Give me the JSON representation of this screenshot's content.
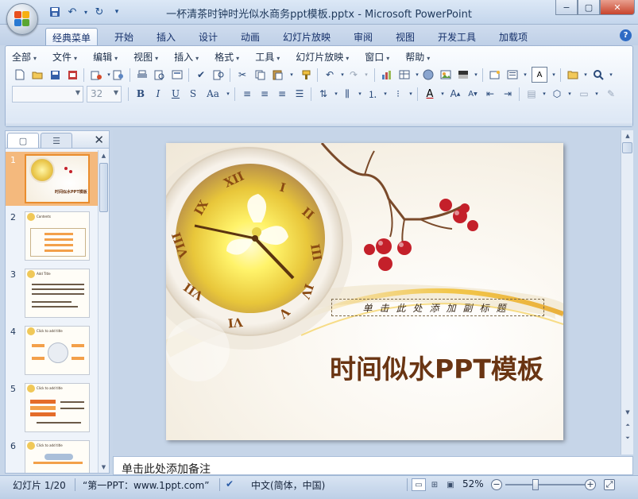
{
  "window": {
    "title": "一杯清茶时钟时光似水商务ppt模板.pptx - Microsoft PowerPoint",
    "controls": [
      "−",
      "▢",
      "✕"
    ]
  },
  "quick_access": {
    "icons": [
      "save-icon",
      "undo-icon",
      "redo-icon",
      "customize-icon"
    ]
  },
  "ribbon_tabs": [
    {
      "label": "经典菜单",
      "active": true
    },
    {
      "label": "开始"
    },
    {
      "label": "插入"
    },
    {
      "label": "设计"
    },
    {
      "label": "动画"
    },
    {
      "label": "幻灯片放映"
    },
    {
      "label": "审阅"
    },
    {
      "label": "视图"
    },
    {
      "label": "开发工具"
    },
    {
      "label": "加载项"
    }
  ],
  "menu": [
    {
      "label": "全部"
    },
    {
      "label": "文件"
    },
    {
      "label": "编辑"
    },
    {
      "label": "视图"
    },
    {
      "label": "插入"
    },
    {
      "label": "格式"
    },
    {
      "label": "工具"
    },
    {
      "label": "幻灯片放映"
    },
    {
      "label": "窗口"
    },
    {
      "label": "帮助"
    }
  ],
  "format": {
    "font_name": "",
    "font_size": "32",
    "bold": "B",
    "italic": "I",
    "underline": "U",
    "strike": "S",
    "case": "Aa",
    "font_color": "A",
    "text_box": "A"
  },
  "slides_pane": {
    "tabs": [
      "slides-tab",
      "outline-tab"
    ],
    "close": "✕",
    "thumbnails": [
      {
        "number": "1",
        "selected": true,
        "caption": "时间似水PPT模板"
      },
      {
        "number": "2",
        "caption": "Contents"
      },
      {
        "number": "3",
        "caption": "Add Title"
      },
      {
        "number": "4",
        "caption": "Click to add title"
      },
      {
        "number": "5",
        "caption": "Click to add title"
      },
      {
        "number": "6",
        "caption": "Click to add title"
      }
    ]
  },
  "slide": {
    "subtitle": "单击此处添加副标题",
    "title": "时间似水PPT模板"
  },
  "notes_placeholder": "单击此处添加备注",
  "status": {
    "slide_counter": "幻灯片 1/20",
    "theme": "“第一PPT：www.1ppt.com”",
    "language": "中文(简体，中国)",
    "zoom": "52%",
    "zoom_fraction": 0.38
  },
  "colors": {
    "title_brown": "#6a3513",
    "selected_thumb": "#f4b97d",
    "ribbon_bg": "#dbe6f4"
  }
}
